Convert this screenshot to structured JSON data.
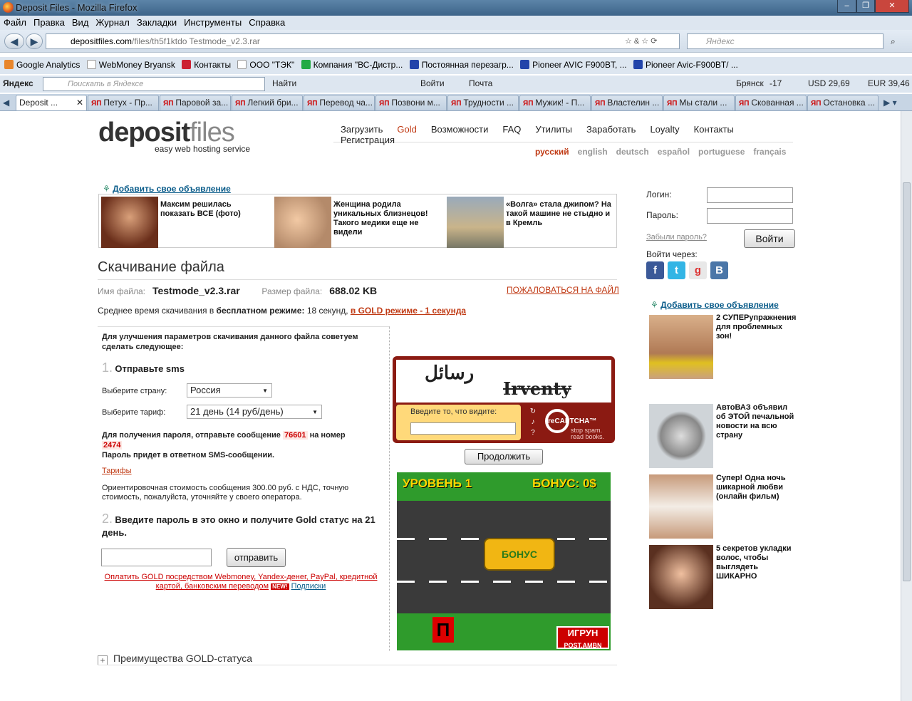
{
  "window": {
    "title": "Deposit Files - Mozilla Firefox"
  },
  "menu": [
    "Файл",
    "Правка",
    "Вид",
    "Журнал",
    "Закладки",
    "Инструменты",
    "Справка"
  ],
  "nav": {
    "url_host": "depositfiles.com",
    "url_path": "/files/th5f1ktdo Testmode_v2.3.rar",
    "search_placeholder": "Яндекс"
  },
  "bookmarks": [
    "Google Analytics",
    "WebMoney Bryansk",
    "Контакты",
    "ООО \"ТЭК\"",
    "Компания \"ВС-Дистр...",
    "Постоянная перезагр...",
    "Pioneer AVIC F900BT, ...",
    "Pioneer Avic-F900BT/ ..."
  ],
  "yandex_bar": {
    "brand": "Яндекс",
    "search_placeholder": "Поискать в Яндексе",
    "find": "Найти",
    "enter": "Войти",
    "mail": "Почта",
    "city": "Брянск",
    "temp": "-17",
    "usd": "USD 29,69",
    "eur": "EUR 39,46"
  },
  "tabs": [
    "Deposit ...",
    "Петух - Пр...",
    "Паровой за...",
    "Легкий бри...",
    "Перевод ча...",
    "Позвони м...",
    "Трудности ...",
    "Мужик! - П...",
    "Властелин ...",
    "Мы стали ...",
    "Скованная ...",
    "Остановка ..."
  ],
  "logo": {
    "part1": "deposit",
    "part2": "files",
    "tagline": "easy web hosting service"
  },
  "mainnav": [
    "Загрузить",
    "Gold",
    "Возможности",
    "FAQ",
    "Утилиты",
    "Заработать",
    "Loyalty",
    "Контакты",
    "Регистрация"
  ],
  "langs": [
    "русский",
    "english",
    "deutsch",
    "español",
    "portuguese",
    "français"
  ],
  "ad_link": "Добавить свое объявление",
  "top_ads": [
    "Максим решилась показать ВСЕ (фото)",
    "Женщина родила уникальных близнецов! Такого медики еще не видели",
    "«Волга» стала джипом? На такой машине не стыдно и в Кремль"
  ],
  "download": {
    "title": "Скачивание файла",
    "file_label": "Имя файла:",
    "file_name": "Testmode_v2.3.rar",
    "size_label": "Размер файла:",
    "file_size": "688.02 KB",
    "abuse": "ПОЖАЛОВАТЬСЯ НА ФАЙЛ",
    "avg_pre": "Среднее время скачивания в",
    "avg_free": "бесплатном режиме:",
    "avg_time": "18 секунд,",
    "avg_gold": "в GOLD режиме - 1 секунда"
  },
  "sms": {
    "intro": "Для улучшения параметров скачивания данного файла советуем сделать следующее:",
    "step1_n": "1.",
    "step1": "Отправьте sms",
    "country_label": "Выберите страну:",
    "country": "Россия",
    "tariff_label": "Выберите тариф:",
    "tariff": "21 день (14 руб/день)",
    "msg_pre": "Для получения пароля, отправьте сообщение",
    "code": "76601",
    "msg_mid": "на номер",
    "number": "2474",
    "msg_post": "Пароль придет в ответном SMS-сообщении.",
    "tariffs_link": "Тарифы",
    "cost": "Ориентировочная стоимость сообщения 300.00 руб. с НДС, точную стоимость, пожалуйста, уточняйте у своего оператора.",
    "step2_n": "2.",
    "step2": "Введите пароль в это окно и получите Gold статус на 21 день.",
    "send": "отправить",
    "pay_link": "Оплатить GOLD посредством Webmoney, Yandex-денег, PayPal, кредитной картой, банковским переводом",
    "new_badge": "NEW!",
    "subs_link": "Подписки"
  },
  "captcha": {
    "word1": "رسائل",
    "word2": "Irventy",
    "prompt": "Введите то, что видите:",
    "brand": "reCAPTCHA™",
    "slogan": "stop spam. read books."
  },
  "continue": "Продолжить",
  "game": {
    "level": "УРОВЕНЬ 1",
    "bonus": "БОНУС: 0$",
    "truck": "БОНУС",
    "brand": "ИГРУН",
    "brand2": "POST.AMBN"
  },
  "gold_adv": "Преимущества GOLD-статуса",
  "login": {
    "login_label": "Логин:",
    "password_label": "Пароль:",
    "forgot": "Забыли пароль?",
    "submit": "Войти",
    "via": "Войти через:"
  },
  "right_ads": [
    "2 СУПЕРупражнения для проблемных зон!",
    "АвтоВАЗ объявил об ЭТОЙ печальной новости на всю страну",
    "Супер! Одна ночь шикарной любви (онлайн фильм)",
    "5 секретов укладки волос, чтобы выглядеть ШИКАРНО"
  ],
  "colors": {
    "accent": "#c03a14",
    "link": "#0a5c8a",
    "captcha": "#8b1a12"
  }
}
